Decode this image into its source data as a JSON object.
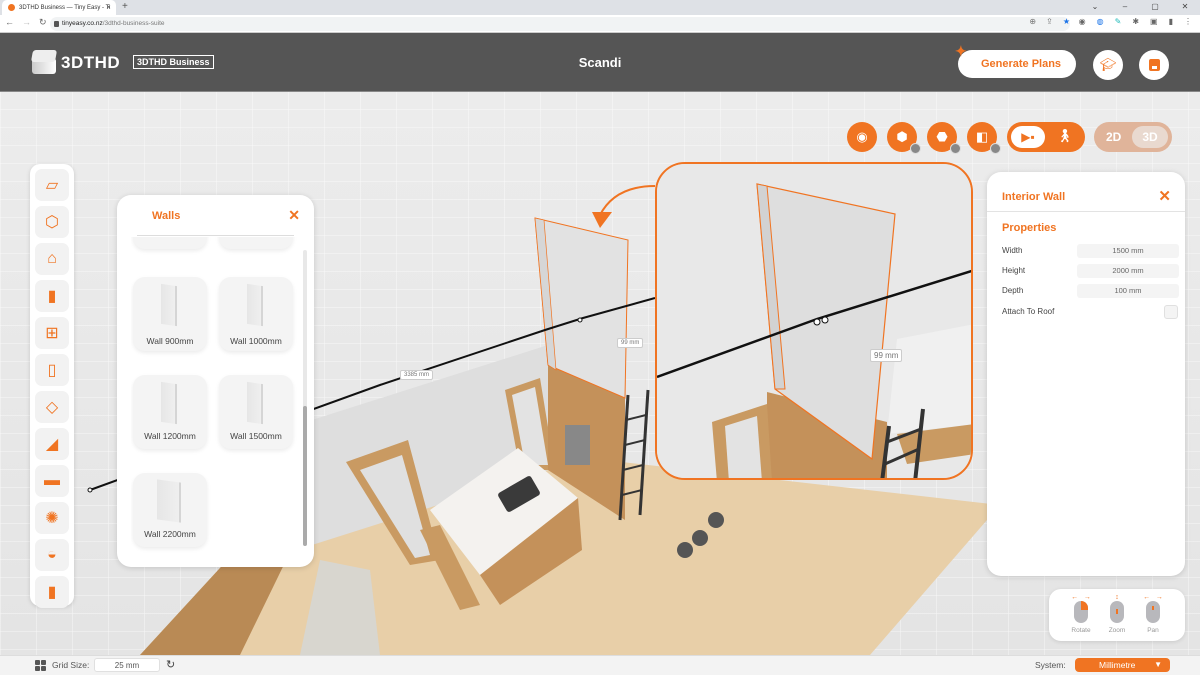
{
  "browser": {
    "tab_title": "3DTHD Business — Tiny Easy - Ti",
    "url_domain": "tinyeasy.co.nz",
    "url_path": "/3dthd-business-suite",
    "new_tab": "+",
    "window_controls": [
      "⌄",
      "–",
      "▢",
      "✕"
    ]
  },
  "header": {
    "logo_text": "3DTHD",
    "badge": "3DTHD Business",
    "project_title": "Scandi",
    "generate_label": "Generate Plans",
    "tutorial_icon": "graduation-cap-icon",
    "save_icon": "save-icon"
  },
  "view_toolbar": {
    "tools": [
      {
        "name": "measure-tape-icon"
      },
      {
        "name": "box-visibility-icon"
      },
      {
        "name": "floor-visibility-icon"
      },
      {
        "name": "wall-visibility-icon"
      }
    ],
    "camera_modes": [
      "orbit-camera-icon",
      "walk-icon"
    ],
    "dimension_modes": {
      "d2": "2D",
      "d3": "3D",
      "active": "3D"
    }
  },
  "sidebar": {
    "items": [
      {
        "name": "trailer-icon",
        "glyph": "▱"
      },
      {
        "name": "box-icon",
        "glyph": "⬡"
      },
      {
        "name": "roof-icon",
        "glyph": "⌂"
      },
      {
        "name": "door-icon",
        "glyph": "▮"
      },
      {
        "name": "window-icon",
        "glyph": "⊞"
      },
      {
        "name": "wall-icon",
        "glyph": "▯"
      },
      {
        "name": "floor-icon",
        "glyph": "◇"
      },
      {
        "name": "stairs-icon",
        "glyph": "◢"
      },
      {
        "name": "sofa-icon",
        "glyph": "▬"
      },
      {
        "name": "light-icon",
        "glyph": "✺"
      },
      {
        "name": "paint-icon",
        "glyph": "◒"
      },
      {
        "name": "bookmark-icon",
        "glyph": "▮"
      }
    ]
  },
  "walls_panel": {
    "title": "Walls",
    "close": "✕",
    "items": [
      {
        "label": "Wall 900mm"
      },
      {
        "label": "Wall 1000mm"
      },
      {
        "label": "Wall 1200mm"
      },
      {
        "label": "Wall 1500mm"
      },
      {
        "label": "Wall 2200mm"
      }
    ]
  },
  "properties_panel": {
    "title": "Interior Wall",
    "close": "✕",
    "section": "Properties",
    "fields": [
      {
        "label": "Width",
        "value": "1500 mm"
      },
      {
        "label": "Height",
        "value": "2000 mm"
      },
      {
        "label": "Depth",
        "value": "100 mm"
      }
    ],
    "attach_label": "Attach To Roof",
    "attach_checked": false
  },
  "scene": {
    "dimension_labels": [
      "3385 mm",
      "99 mm",
      "99 mm"
    ]
  },
  "controls_hint": {
    "items": [
      {
        "label": "Rotate"
      },
      {
        "label": "Zoom"
      },
      {
        "label": "Pan"
      }
    ]
  },
  "bottom_bar": {
    "grid_label": "Grid Size:",
    "grid_value": "25 mm",
    "reset_icon": "↻",
    "system_label": "System:",
    "system_value": "Millimetre",
    "caret": "▼"
  },
  "colors": {
    "accent": "#f07422",
    "header_bg": "#555555"
  }
}
